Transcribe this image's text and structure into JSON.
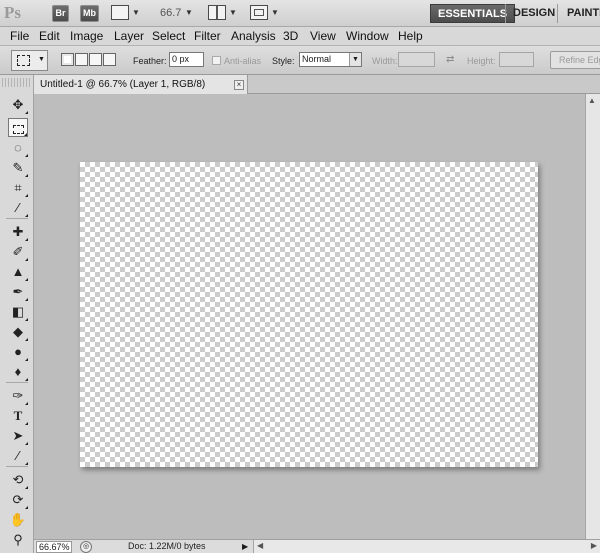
{
  "app": {
    "logo": "Ps",
    "bridge_label": "Br",
    "minibridge_label": "Mb",
    "zoom_level": "66.7",
    "workspaces": [
      "ESSENTIALS",
      "DESIGN",
      "PAINTI"
    ]
  },
  "menu": [
    "File",
    "Edit",
    "Image",
    "Layer",
    "Select",
    "Filter",
    "Analysis",
    "3D",
    "View",
    "Window",
    "Help"
  ],
  "options": {
    "feather_label": "Feather:",
    "feather_value": "0 px",
    "antialias_label": "Anti-alias",
    "style_label": "Style:",
    "style_value": "Normal",
    "width_label": "Width:",
    "height_label": "Height:",
    "refine_label": "Refine Edge..."
  },
  "tools": [
    "move",
    "rectangular-marquee",
    "lasso",
    "quick-selection",
    "crop",
    "eyedropper",
    "spot-healing-brush",
    "brush",
    "clone-stamp",
    "history-brush",
    "eraser",
    "paint-bucket",
    "blur",
    "dodge",
    "pen",
    "horizontal-type",
    "path-selection",
    "line",
    "3d-rotate",
    "3d-orbit",
    "hand",
    "zoom"
  ],
  "document": {
    "tab_title": "Untitled-1 @ 66.7% (Layer 1, RGB/8)",
    "close": "×"
  },
  "status": {
    "zoom": "66.67%",
    "doc_info": "Doc: 1.22M/0 bytes"
  }
}
